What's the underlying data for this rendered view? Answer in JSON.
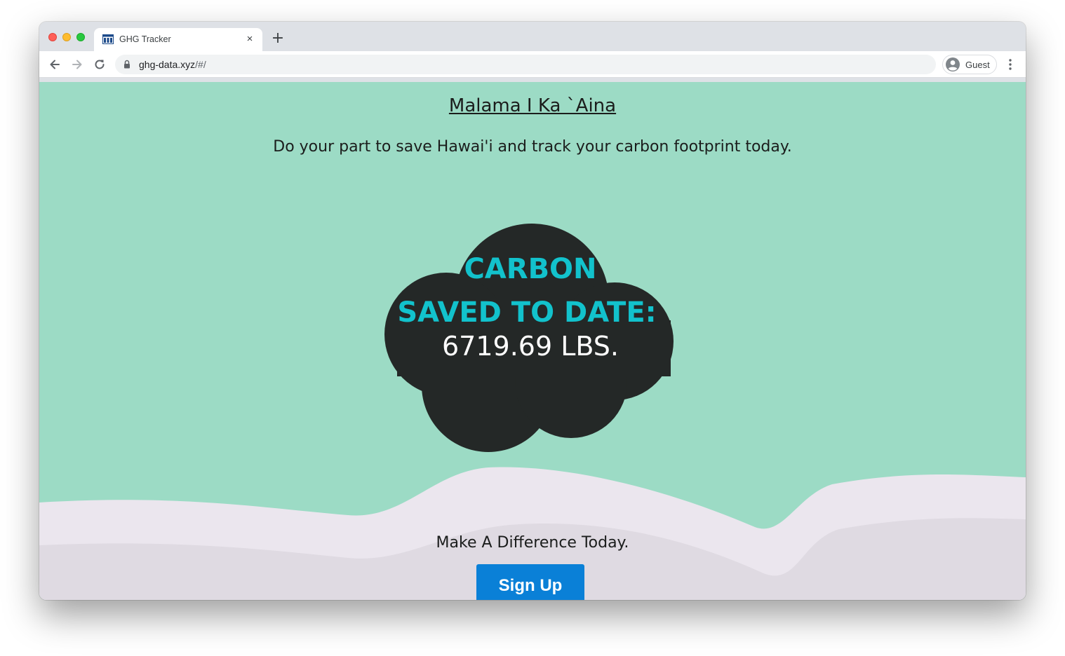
{
  "browser": {
    "tab_title": "GHG Tracker",
    "new_tab_label": "+",
    "close_tab_label": "×",
    "url_host": "ghg-data.xyz",
    "url_path": "/#/",
    "profile_label": "Guest"
  },
  "page": {
    "headline": "Malama I Ka `Aina",
    "tagline": "Do your part to save Hawai'i and track your carbon footprint today.",
    "cloud": {
      "line1": "CARBON",
      "line2": "SAVED TO DATE:",
      "amount": "6719.69 LBS."
    },
    "cta_text": "Make A Difference Today.",
    "signup_label": "Sign Up"
  },
  "colors": {
    "page_background": "#9cdbc5",
    "cloud_fill": "#242827",
    "cloud_heading": "#12c2cc",
    "button": "#0a80d7",
    "wave_light": "#ebe6ee",
    "wave_dark": "#dfdae2"
  },
  "icons": [
    "favicon-icon",
    "close-icon",
    "plus-icon",
    "back-arrow-icon",
    "forward-arrow-icon",
    "reload-icon",
    "lock-icon",
    "avatar-icon",
    "kebab-menu-icon"
  ]
}
